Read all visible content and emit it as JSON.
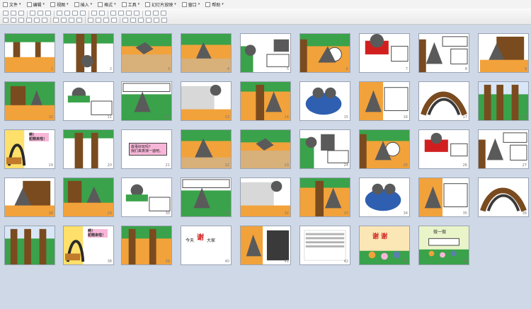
{
  "menubar": {
    "items": [
      {
        "label": "文件",
        "icon": "file-icon"
      },
      {
        "label": "编辑",
        "icon": "edit-icon"
      },
      {
        "label": "视图",
        "icon": "view-icon"
      },
      {
        "label": "插入",
        "icon": "insert-icon"
      },
      {
        "label": "格式",
        "icon": "format-icon"
      },
      {
        "label": "工具",
        "icon": "tools-icon"
      },
      {
        "label": "幻灯片放映",
        "icon": "slideshow-icon"
      },
      {
        "label": "窗口",
        "icon": "window-icon"
      },
      {
        "label": "帮助",
        "icon": "help-icon"
      }
    ]
  },
  "slides": [
    {
      "num": "1"
    },
    {
      "num": "2"
    },
    {
      "num": "3"
    },
    {
      "num": "4"
    },
    {
      "num": "5"
    },
    {
      "num": "6"
    },
    {
      "num": "7"
    },
    {
      "num": "8"
    },
    {
      "num": "9"
    },
    {
      "num": "10"
    },
    {
      "num": "11"
    },
    {
      "num": "12"
    },
    {
      "num": "13"
    },
    {
      "num": "14"
    },
    {
      "num": "15"
    },
    {
      "num": "16"
    },
    {
      "num": "17"
    },
    {
      "num": "18"
    },
    {
      "num": "19"
    },
    {
      "num": "20"
    },
    {
      "num": "21"
    },
    {
      "num": "22"
    },
    {
      "num": "23"
    },
    {
      "num": "24"
    },
    {
      "num": "25"
    },
    {
      "num": "26"
    },
    {
      "num": "27"
    },
    {
      "num": "28"
    },
    {
      "num": "29"
    },
    {
      "num": "30"
    },
    {
      "num": "31"
    },
    {
      "num": "32"
    },
    {
      "num": "33"
    },
    {
      "num": "34"
    },
    {
      "num": "35"
    },
    {
      "num": "36"
    },
    {
      "num": "37"
    },
    {
      "num": "38"
    },
    {
      "num": "39"
    },
    {
      "num": "40"
    },
    {
      "num": "41"
    },
    {
      "num": "42"
    },
    {
      "num": "43"
    },
    {
      "num": "44"
    }
  ],
  "slide_text": {
    "s19": "啊！\n蛇精来啦！",
    "s21": "故事好玩吗？\n我们来表演一遍吧。",
    "s38": "啊！\n蛇精来啦！",
    "s40_a": "今天",
    "s40_b": "谢",
    "s40_c": "大家",
    "s43": "谢 谢",
    "s44_title": "做一做"
  },
  "colors": {
    "accent": "#d11f1f",
    "pink": "#f7b6d8",
    "wolf": "#5a5a5a",
    "orange": "#f2a23a",
    "green": "#3aa24a",
    "brown": "#7a4b1f"
  }
}
